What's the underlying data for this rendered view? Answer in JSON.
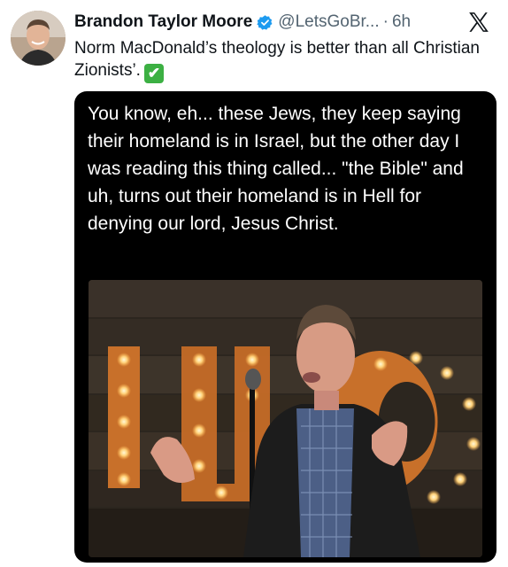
{
  "tweet": {
    "author_name": "Brandon Taylor Moore",
    "handle": "@LetsGoBr...",
    "separator": "·",
    "time": "6h",
    "text": "Norm MacDonald’s theology is better than all Christian Zionists’.",
    "emoji": "✔"
  },
  "media": {
    "quote_text": "You know, eh... these Jews, they keep saying their homeland is in Israel, but the other day I was reading this thing called... \"the Bible\" and uh, turns out their homeland is in Hell for denying our lord, Jesus Christ."
  },
  "icons": {
    "verified": "verified-badge-icon",
    "brand": "x-logo-icon",
    "check": "check-mark-emoji-icon"
  },
  "colors": {
    "verified_blue": "#1d9bf0",
    "check_green": "#3cb043",
    "handle_gray": "#536471",
    "marquee_orange": "#d9772e"
  }
}
